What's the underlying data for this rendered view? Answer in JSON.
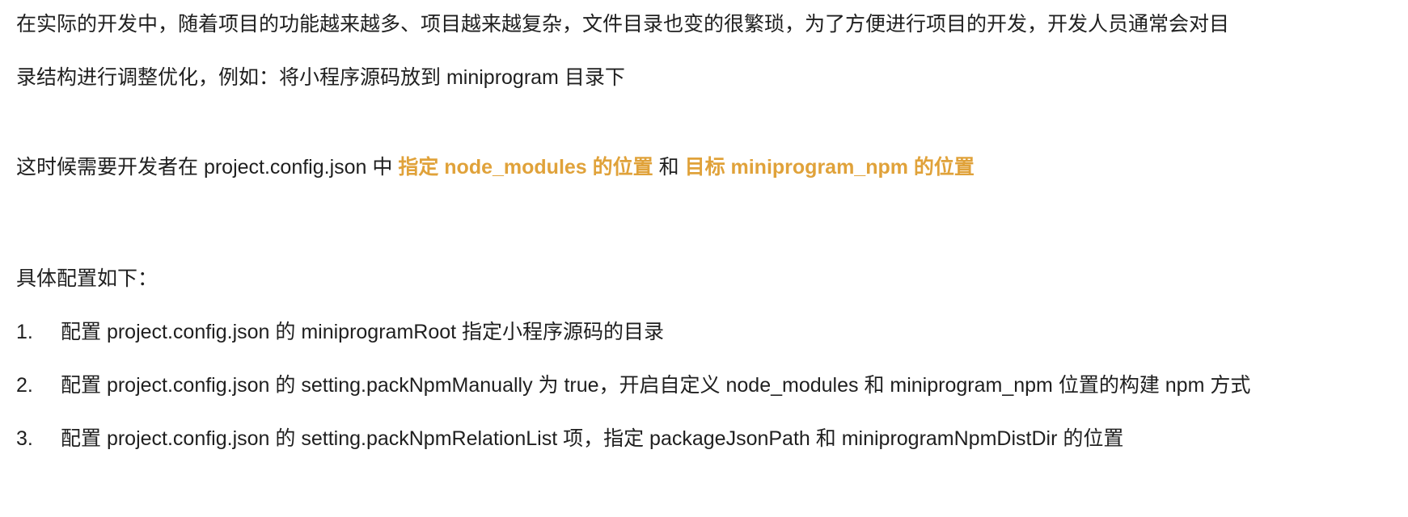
{
  "intro": {
    "line1": "在实际的开发中，随着项目的功能越来越多、项目越来越复杂，文件目录也变的很繁琐，为了方便进行项目的开发，开发人员通常会对目",
    "line2": "录结构进行调整优化，例如：将小程序源码放到 miniprogram 目录下"
  },
  "config_note": {
    "prefix": "这时候需要开发者在 project.config.json 中 ",
    "highlight1": "指定 node_modules 的位置",
    "middle": " 和 ",
    "highlight2": "目标 miniprogram_npm 的位置"
  },
  "steps_heading": "具体配置如下：",
  "steps": [
    {
      "num": "1.",
      "text": "配置 project.config.json 的 miniprogramRoot 指定小程序源码的目录"
    },
    {
      "num": "2.",
      "text": "配置 project.config.json 的 setting.packNpmManually 为 true，开启自定义 node_modules 和 miniprogram_npm 位置的构建 npm 方式"
    },
    {
      "num": "3.",
      "text": "配置 project.config.json 的 setting.packNpmRelationList 项，指定 packageJsonPath 和 miniprogramNpmDistDir 的位置"
    }
  ],
  "colors": {
    "highlight": "#e0a23a",
    "text": "#1f1f1f",
    "background": "#ffffff"
  }
}
